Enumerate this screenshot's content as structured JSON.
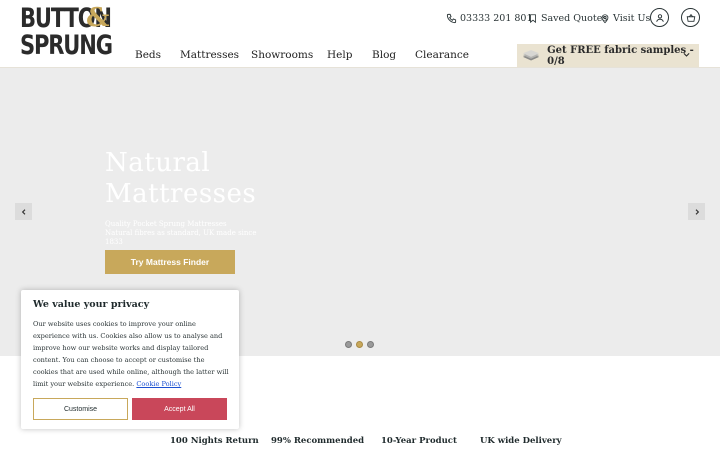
{
  "brand": {
    "line1": "BUTTON",
    "amp": "&",
    "line2": "SPRUNG",
    "tm": "™",
    "accent_color": "#c8a85b"
  },
  "utility": {
    "phone": "03333 201 801",
    "saved_quotes": "Saved Quotes",
    "visit_us": "Visit Us",
    "icons": [
      "phone-icon",
      "bookmark-icon",
      "map-pin-icon",
      "account-icon",
      "basket-icon"
    ]
  },
  "nav": {
    "items": [
      "Beds",
      "Mattresses",
      "Showrooms",
      "Help",
      "Blog",
      "Clearance"
    ]
  },
  "samples": {
    "label": "Get FREE fabric samples - 0/8"
  },
  "hero": {
    "title_line1": "Natural",
    "title_line2": "Mattresses",
    "subtitle_line1": "Quality Pocket Sprung Mattresses",
    "subtitle_line2": "Natural fibres as standard, UK made since 1833",
    "cta": "Try Mattress Finder",
    "active_slide": 2,
    "slide_count": 3
  },
  "usps": [
    "100 Nights Return",
    "99% Recommended",
    "10-Year Product",
    "UK wide Delivery"
  ],
  "cookie": {
    "title": "We value your privacy",
    "text": "Our website uses cookies to improve your online experience with us. Cookies also allow us to analyse and improve how our website works and display tailored content. You can choose to accept or customise the cookies that are used while online, although the latter will limit your website experience.",
    "link": "Cookie Policy",
    "customise": "Customise",
    "accept": "Accept All",
    "accept_color": "#c9475a"
  }
}
